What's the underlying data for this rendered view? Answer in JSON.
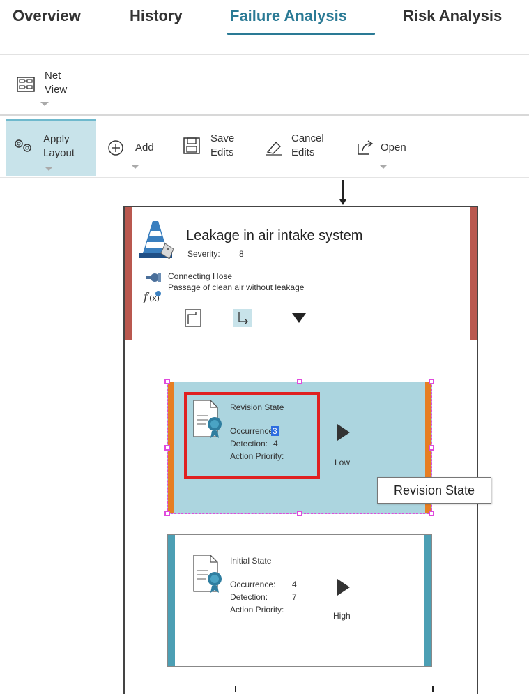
{
  "tabs": [
    {
      "label": "Overview"
    },
    {
      "label": "History"
    },
    {
      "label": "Failure Analysis"
    },
    {
      "label": "Risk Analysis"
    }
  ],
  "active_tab": "Failure Analysis",
  "netview": {
    "line1": "Net",
    "line2": "View"
  },
  "toolbar": {
    "apply": {
      "line1": "Apply",
      "line2": "Layout"
    },
    "add": "Add",
    "save": {
      "line1": "Save",
      "line2": "Edits"
    },
    "cancel": {
      "line1": "Cancel",
      "line2": "Edits"
    },
    "open": "Open"
  },
  "failure": {
    "title": "Leakage in air intake system",
    "severity_label": "Severity:",
    "severity_value": "8",
    "component": "Connecting Hose",
    "function": "Passage of clean air without leakage"
  },
  "revision": {
    "title": "Revision State",
    "occurrence_label": "Occurrence:",
    "occurrence_value": "3",
    "detection_label": "Detection:",
    "detection_value": "4",
    "ap_label": "Action Priority:",
    "ap_value": "Low"
  },
  "tooltip": "Revision State",
  "initial": {
    "title": "Initial State",
    "occurrence_label": "Occurrence:",
    "occurrence_value": "4",
    "detection_label": "Detection:",
    "detection_value": "7",
    "ap_label": "Action Priority:",
    "ap_value": "High"
  },
  "colors": {
    "accent": "#2a7a95",
    "failure_bar": "#b9584f",
    "revision_bg": "#acd5df",
    "revision_bar": "#e67e22",
    "initial_bar": "#4c9fb4",
    "selection": "#e02020"
  }
}
